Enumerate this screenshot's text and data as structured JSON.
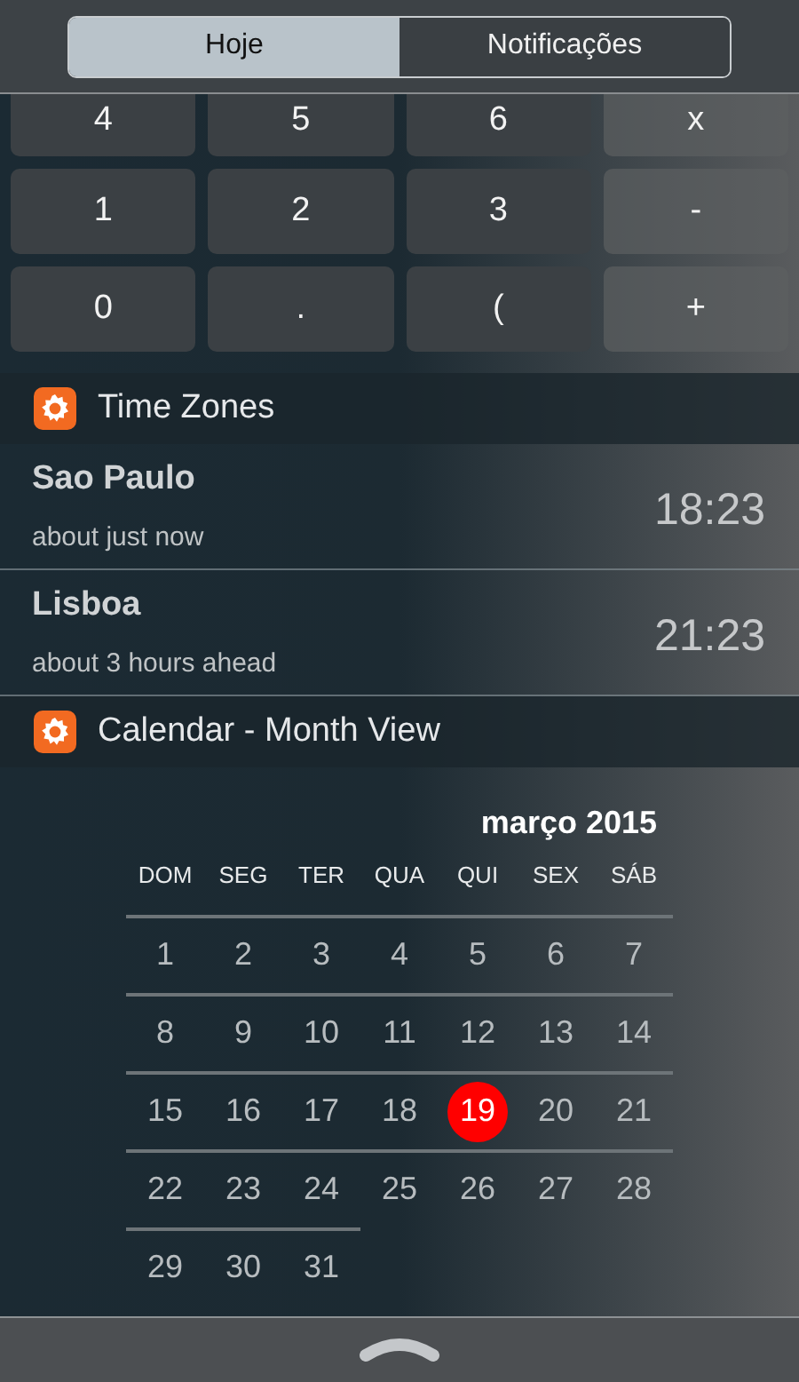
{
  "tabs": [
    {
      "label": "Hoje",
      "selected": true
    },
    {
      "label": "Notificações",
      "selected": false
    }
  ],
  "keypad": {
    "rows": [
      [
        "4",
        "5",
        "6",
        "x"
      ],
      [
        "1",
        "2",
        "3",
        "-"
      ],
      [
        "0",
        ".",
        "(",
        "+"
      ]
    ]
  },
  "time_zones": {
    "title": "Time Zones",
    "rows": [
      {
        "city": "Sao Paulo",
        "note": "about just now",
        "time": "18:23"
      },
      {
        "city": "Lisboa",
        "note": "about 3 hours ahead",
        "time": "21:23"
      }
    ]
  },
  "calendar": {
    "title": "Calendar - Month View",
    "month": "março 2015",
    "weekdays": [
      "DOM",
      "SEG",
      "TER",
      "QUA",
      "QUI",
      "SEX",
      "SÁB"
    ],
    "weeks": [
      [
        {
          "day": "1",
          "selected": false
        },
        {
          "day": "2",
          "selected": false
        },
        {
          "day": "3",
          "selected": false
        },
        {
          "day": "4",
          "selected": false
        },
        {
          "day": "5",
          "selected": false
        },
        {
          "day": "6",
          "selected": false
        },
        {
          "day": "7",
          "selected": false
        }
      ],
      [
        {
          "day": "8",
          "selected": false
        },
        {
          "day": "9",
          "selected": false
        },
        {
          "day": "10",
          "selected": false
        },
        {
          "day": "11",
          "selected": false
        },
        {
          "day": "12",
          "selected": false
        },
        {
          "day": "13",
          "selected": false
        },
        {
          "day": "14",
          "selected": false
        }
      ],
      [
        {
          "day": "15",
          "selected": false
        },
        {
          "day": "16",
          "selected": false
        },
        {
          "day": "17",
          "selected": false
        },
        {
          "day": "18",
          "selected": false
        },
        {
          "day": "19",
          "selected": true
        },
        {
          "day": "20",
          "selected": false
        },
        {
          "day": "21",
          "selected": false
        }
      ],
      [
        {
          "day": "22",
          "selected": false
        },
        {
          "day": "23",
          "selected": false
        },
        {
          "day": "24",
          "selected": false
        },
        {
          "day": "25",
          "selected": false
        },
        {
          "day": "26",
          "selected": false
        },
        {
          "day": "27",
          "selected": false
        },
        {
          "day": "28",
          "selected": false
        }
      ],
      [
        {
          "day": "29",
          "selected": false
        },
        {
          "day": "30",
          "selected": false
        },
        {
          "day": "31",
          "selected": false
        }
      ]
    ]
  }
}
